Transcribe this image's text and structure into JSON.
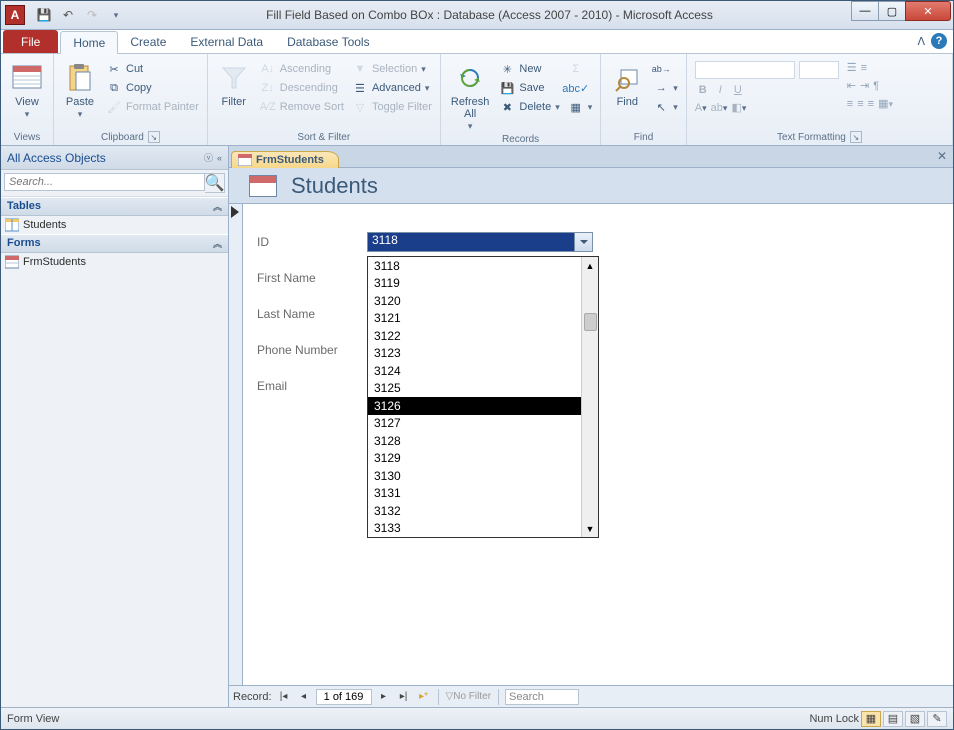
{
  "titlebar": {
    "app_letter": "A",
    "title": "Fill Field Based on Combo BOx : Database (Access 2007 - 2010)  -  Microsoft Access"
  },
  "ribbon_tabs": {
    "file": "File",
    "home": "Home",
    "create": "Create",
    "external_data": "External Data",
    "database_tools": "Database Tools"
  },
  "ribbon": {
    "views": {
      "view": "View",
      "group": "Views"
    },
    "clipboard": {
      "paste": "Paste",
      "cut": "Cut",
      "copy": "Copy",
      "format_painter": "Format Painter",
      "group": "Clipboard"
    },
    "sortfilter": {
      "filter": "Filter",
      "ascending": "Ascending",
      "descending": "Descending",
      "remove_sort": "Remove Sort",
      "selection": "Selection",
      "advanced": "Advanced",
      "toggle_filter": "Toggle Filter",
      "group": "Sort & Filter"
    },
    "records": {
      "refresh_all": "Refresh\nAll",
      "new": "New",
      "save": "Save",
      "delete": "Delete",
      "totals": "Σ",
      "spelling": "✓",
      "more": "≡",
      "group": "Records"
    },
    "find": {
      "find": "Find",
      "group": "Find"
    },
    "textfmt": {
      "group": "Text Formatting"
    }
  },
  "nav": {
    "header": "All Access Objects",
    "search_placeholder": "Search...",
    "groups": {
      "tables": "Tables",
      "forms": "Forms"
    },
    "items": {
      "students": "Students",
      "frmstudents": "FrmStudents"
    }
  },
  "doc_tab": {
    "label": "FrmStudents"
  },
  "form": {
    "title": "Students",
    "labels": {
      "id": "ID",
      "first_name": "First Name",
      "last_name": "Last Name",
      "phone": "Phone Number",
      "email": "Email"
    },
    "combo_value": "3118",
    "dropdown_items": [
      "3118",
      "3119",
      "3120",
      "3121",
      "3122",
      "3123",
      "3124",
      "3125",
      "3126",
      "3127",
      "3128",
      "3129",
      "3130",
      "3131",
      "3132",
      "3133"
    ],
    "highlight_index": 8
  },
  "record_nav": {
    "label": "Record:",
    "position": "1 of 169",
    "no_filter": "No Filter",
    "search": "Search"
  },
  "statusbar": {
    "left": "Form View",
    "numlock": "Num Lock"
  }
}
